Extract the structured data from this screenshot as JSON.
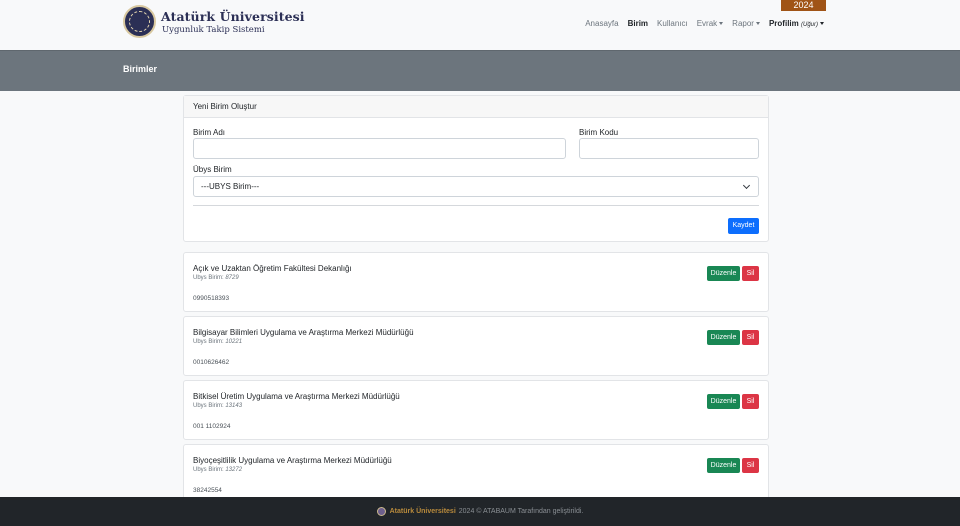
{
  "brand": {
    "title": "Atatürk Üniversitesi",
    "subtitle": "Uygunluk Takip Sistemi",
    "year": "2024"
  },
  "nav": {
    "items": [
      {
        "label": "Anasayfa",
        "active": false,
        "dropdown": false
      },
      {
        "label": "Birim",
        "active": true,
        "dropdown": false
      },
      {
        "label": "Kullanıcı",
        "active": false,
        "dropdown": false
      },
      {
        "label": "Evrak",
        "active": false,
        "dropdown": true
      },
      {
        "label": "Rapor",
        "active": false,
        "dropdown": true
      }
    ],
    "profile_label": "Profilim",
    "profile_user": "(Uğur)"
  },
  "page": {
    "title": "Birimler"
  },
  "form": {
    "header": "Yeni Birim Oluştur",
    "name_label": "Birim Adı",
    "name_value": "",
    "code_label": "Birim Kodu",
    "code_value": "",
    "ubys_label": "Übys Birim",
    "ubys_selected": "---UBYS Birim---",
    "save_label": "Kaydet"
  },
  "units": {
    "ubys_prefix": "Ubys Birim:",
    "edit_label": "Düzenle",
    "delete_label": "Sil",
    "items": [
      {
        "name": "Açık ve Uzaktan Öğretim Fakültesi Dekanlığı",
        "ubys": "8729",
        "code": "0990518393"
      },
      {
        "name": "Bilgisayar Bilimleri Uygulama ve Araştırma Merkezi Müdürlüğü",
        "ubys": "10221",
        "code": "0010626462"
      },
      {
        "name": "Bitkisel Üretim Uygulama ve Araştırma Merkezi Müdürlüğü",
        "ubys": "13143",
        "code": "001 1102924"
      },
      {
        "name": "Biyoçeşitlilik Uygulama ve Araştırma Merkezi Müdürlüğü",
        "ubys": "13272",
        "code": "38242554"
      }
    ]
  },
  "footer": {
    "brand": "Atatürk Üniversitesi",
    "text": "2024 © ATABAUM Tarafından geliştirildi."
  },
  "colors": {
    "primary": "#0d6efd",
    "success": "#198754",
    "danger": "#dc3545",
    "band": "#6c757d",
    "footer": "#212529",
    "year_badge": "#a05416",
    "brand_navy": "#2b2f55"
  }
}
